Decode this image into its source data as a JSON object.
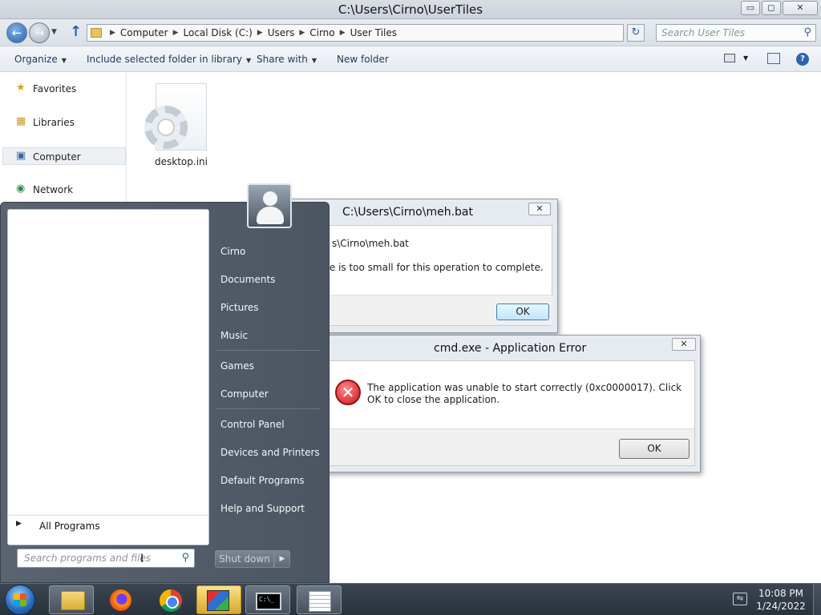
{
  "explorer": {
    "title": "C:\\Users\\Cirno\\UserTiles",
    "window_controls": {
      "minimize": "▭",
      "maximize": "◻",
      "close": "✕"
    },
    "breadcrumb": [
      "Computer",
      "Local Disk (C:)",
      "Users",
      "Cirno",
      "User Tiles"
    ],
    "search_placeholder": "Search User Tiles",
    "toolbar": {
      "organize": "Organize",
      "include_library": "Include selected folder in library",
      "share_with": "Share with",
      "new_folder": "New folder"
    },
    "nav": {
      "favorites": "Favorites",
      "libraries": "Libraries",
      "computer": "Computer",
      "network": "Network"
    },
    "files": [
      {
        "name": "desktop.ini",
        "icon": "settings-file-icon"
      }
    ]
  },
  "dialog_mehbat": {
    "title": "C:\\Users\\Cirno\\meh.bat",
    "line1": "s\\Cirno\\meh.bat",
    "line2": "ging file is too small for this operation to complete.",
    "ok": "OK",
    "close": "✕"
  },
  "dialog_cmd": {
    "title": "cmd.exe - Application Error",
    "message": "The application was unable to start correctly (0xc0000017). Click OK to close the application.",
    "ok": "OK",
    "close": "✕",
    "icon": "error-icon"
  },
  "start_menu": {
    "all_programs": "All Programs",
    "search_placeholder": "Search programs and files",
    "right_items": [
      "Cirno",
      "Documents",
      "Pictures",
      "Music",
      "Games",
      "Computer",
      "Control Panel",
      "Devices and Printers",
      "Default Programs",
      "Help and Support"
    ],
    "shutdown": "Shut down"
  },
  "taskbar": {
    "time": "10:08 PM",
    "date": "1/24/2022",
    "apps": [
      "explorer",
      "firefox",
      "chrome",
      "setup",
      "cmd",
      "notepad"
    ],
    "cmd_glyph": "C:\\_"
  }
}
